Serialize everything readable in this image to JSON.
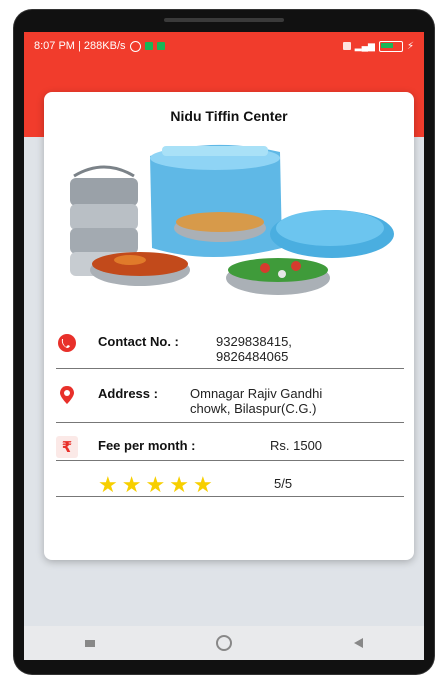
{
  "status_bar": {
    "time_speed": "8:07 PM | 288KB/s"
  },
  "card": {
    "title": "Nidu Tiffin Center",
    "image_label": "tiffin-photo",
    "contact": {
      "label": "Contact No. :",
      "line1": "9329838415,",
      "line2": "9826484065"
    },
    "address": {
      "label": "Address :",
      "line1": "Omnagar Rajiv Gandhi",
      "line2": "chowk, Bilaspur(C.G.)"
    },
    "fee": {
      "label": "Fee per month :",
      "value": "Rs. 1500"
    },
    "rating": {
      "stars": 5,
      "text": "5/5"
    }
  },
  "colors": {
    "accent": "#f13c2c",
    "star": "#f7cf00"
  }
}
